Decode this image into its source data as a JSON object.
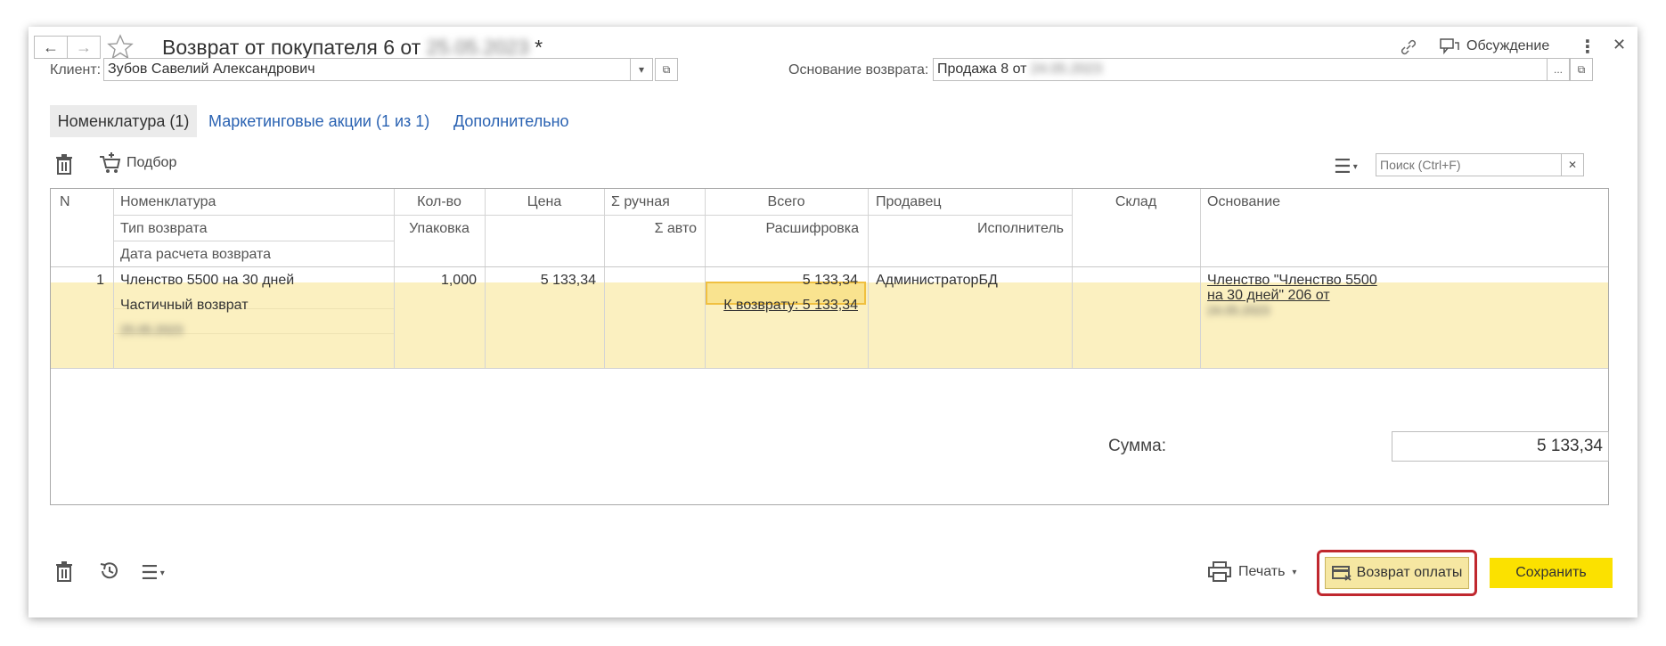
{
  "window": {
    "title": "Возврат от покупателя 6 от",
    "title_date": "25.05.2023",
    "title_modified": "*",
    "discussion_label": "Обсуждение"
  },
  "header": {
    "client_label": "Клиент:",
    "client_value": "Зубов Савелий Александрович",
    "basis_label": "Основание возврата:",
    "basis_value": "Продажа 8 от",
    "basis_date": "24.05.2023"
  },
  "tabs": [
    {
      "label": "Номенклатура (1)"
    },
    {
      "label": "Маркетинговые акции (1 из 1)"
    },
    {
      "label": "Дополнительно"
    }
  ],
  "toolbar": {
    "pick_label": "Подбор",
    "search_placeholder": "Поиск (Ctrl+F)"
  },
  "table": {
    "headers": {
      "n": "N",
      "nomenclature": "Номенклатура",
      "return_type": "Тип возврата",
      "return_date": "Дата расчета возврата",
      "qty": "Кол-во",
      "package": "Упаковка",
      "price": "Цена",
      "sum_manual": "Σ ручная",
      "sum_auto": "Σ авто",
      "total": "Всего",
      "decoding": "Расшифровка",
      "seller": "Продавец",
      "executor": "Исполнитель",
      "warehouse": "Склад",
      "basis": "Основание"
    },
    "rows": [
      {
        "n": "1",
        "nomenclature": "Членство 5500 на 30 дней",
        "return_type": "Частичный возврат",
        "return_date": "25.05.2023",
        "qty": "1,000",
        "price": "5 133,34",
        "total": "5 133,34",
        "to_return": "К возврату: 5 133,34",
        "seller": "АдминистраторБД",
        "basis_line1": "Членство \"Членство 5500",
        "basis_line2": "на 30 дней\" 206 от",
        "basis_date": "24.05.2023"
      }
    ]
  },
  "footer": {
    "sum_label": "Сумма:",
    "sum_value": "5 133,34",
    "print_label": "Печать",
    "return_payment_label": "Возврат оплаты",
    "save_label": "Сохранить"
  }
}
